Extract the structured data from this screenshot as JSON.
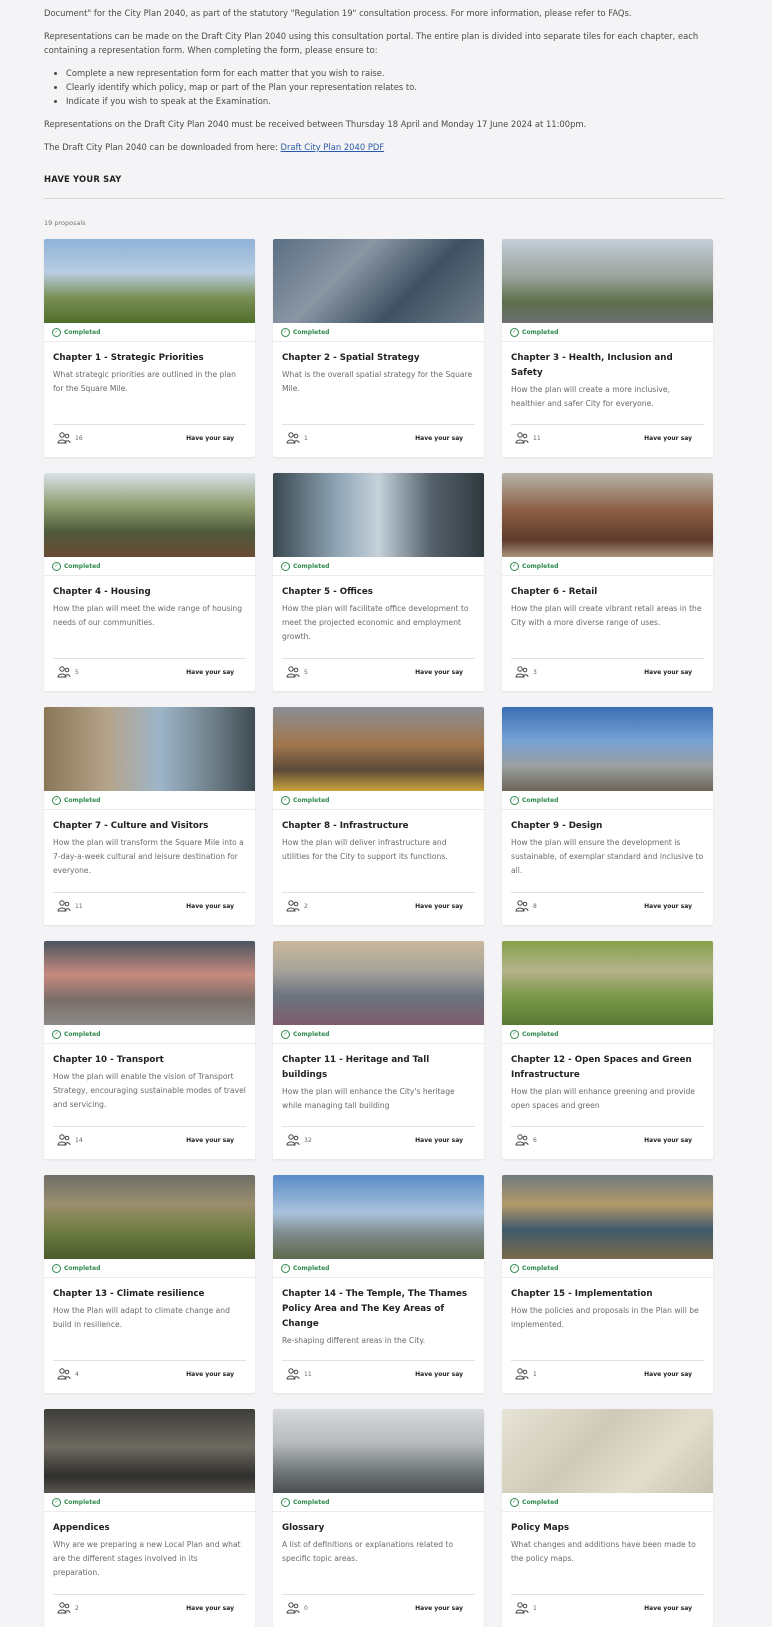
{
  "intro": {
    "line1": "Document\" for the City Plan 2040, as part of the statutory \"Regulation 19\" consultation process. For more information, please refer to FAQs.",
    "line2": "Representations can be made on the Draft City Plan 2040 using this consultation portal. The entire plan is divided into separate tiles for each chapter, each containing a representation form. When completing the form, please ensure to:",
    "bullets": [
      "Complete a new representation form for each matter that you wish to raise.",
      "Clearly identify which policy, map or part of the Plan your representation relates to.",
      "Indicate if you wish to speak at the Examination."
    ],
    "dates": "Representations on the Draft City Plan 2040 must be received between Thursday 18 April and Monday 17 June 2024 at 11:00pm.",
    "download_prefix": "The Draft City Plan 2040 can be downloaded from here:",
    "download_link": "Draft City Plan 2040 PDF"
  },
  "section_title": "HAVE YOUR SAY",
  "proposals_count": "19 proposals",
  "cards": [
    {
      "title": "Chapter 1 - Strategic Priorities",
      "desc": "What strategic priorities are outlined in the plan for the Square Mile.",
      "status": "Completed",
      "count": "16",
      "action": "Have your say",
      "icon": "st-pauls-photo"
    },
    {
      "title": "Chapter 2 - Spatial Strategy",
      "desc": "What is the overall spatial strategy for the Square Mile.",
      "status": "Completed",
      "count": "1",
      "action": "Have your say",
      "icon": "aerial-city-photo"
    },
    {
      "title": "Chapter 3 - Health, Inclusion and Safety",
      "desc": "How the plan will create a more inclusive, healthier and safer City for everyone.",
      "status": "Completed",
      "count": "11",
      "action": "Have your say",
      "icon": "runners-photo"
    },
    {
      "title": "Chapter 4 - Housing",
      "desc": "How the plan will meet the wide range of housing needs of our communities.",
      "status": "Completed",
      "count": "5",
      "action": "Have your say",
      "icon": "housing-photo"
    },
    {
      "title": "Chapter 5 - Offices",
      "desc": "How the plan will facilitate office development to meet the projected economic and employment growth.",
      "status": "Completed",
      "count": "5",
      "action": "Have your say",
      "icon": "offices-photo"
    },
    {
      "title": "Chapter 6 - Retail",
      "desc": "How the plan will create vibrant retail areas in the City with a more diverse range of uses.",
      "status": "Completed",
      "count": "3",
      "action": "Have your say",
      "icon": "market-photo"
    },
    {
      "title": "Chapter 7 - Culture and Visitors",
      "desc": "How the plan will transform the Square Mile into a 7-day-a-week cultural and leisure destination for everyone.",
      "status": "Completed",
      "count": "11",
      "action": "Have your say",
      "icon": "church-photo"
    },
    {
      "title": "Chapter 8 - Infrastructure",
      "desc": "How the plan will deliver infrastructure and utilities for the City to support its functions.",
      "status": "Completed",
      "count": "2",
      "action": "Have your say",
      "icon": "construction-photo"
    },
    {
      "title": "Chapter 9 - Design",
      "desc": "How the plan will ensure the development is sustainable, of exemplar standard and inclusive to all.",
      "status": "Completed",
      "count": "8",
      "action": "Have your say",
      "icon": "skyline-photo"
    },
    {
      "title": "Chapter 10 - Transport",
      "desc": "How the plan will enable the vision of Transport Strategy, encouraging sustainable modes of travel and servicing.",
      "status": "Completed",
      "count": "14",
      "action": "Have your say",
      "icon": "cyclists-photo"
    },
    {
      "title": "Chapter 11 - Heritage and Tall buildings",
      "desc": "How the plan will enhance the City's heritage while managing tall building",
      "status": "Completed",
      "count": "32",
      "action": "Have your say",
      "icon": "dome-skyline-photo"
    },
    {
      "title": "Chapter 12 - Open Spaces and Green Infrastructure",
      "desc": "How the plan will enhance greening and provide open spaces and green",
      "status": "Completed",
      "count": "6",
      "action": "Have your say",
      "icon": "park-photo"
    },
    {
      "title": "Chapter 13 - Climate resilience",
      "desc": "How the Plan will adapt to climate change and build in resilience.",
      "status": "Completed",
      "count": "4",
      "action": "Have your say",
      "icon": "garden-photo"
    },
    {
      "title": "Chapter 14 - The Temple, The Thames Policy Area and The Key Areas of Change",
      "desc": "Re-shaping different areas in the City.",
      "status": "Completed",
      "count": "11",
      "action": "Have your say",
      "icon": "thames-photo"
    },
    {
      "title": "Chapter 15 - Implementation",
      "desc": "How the policies and proposals in the Plan will be implemented.",
      "status": "Completed",
      "count": "1",
      "action": "Have your say",
      "icon": "glass-roof-photo"
    },
    {
      "title": "Appendices",
      "desc": "Why are we preparing a new Local Plan and what are the different stages involved in its preparation.",
      "status": "Completed",
      "count": "2",
      "action": "Have your say",
      "icon": "exhibition-photo"
    },
    {
      "title": "Glossary",
      "desc": "A list of definitions or explanations related to specific topic areas.",
      "status": "Completed",
      "count": "0",
      "action": "Have your say",
      "icon": "viewing-gallery-photo"
    },
    {
      "title": "Policy Maps",
      "desc": "What changes and additions have been made to the policy maps.",
      "status": "Completed",
      "count": "1",
      "action": "Have your say",
      "icon": "map-photo"
    }
  ]
}
